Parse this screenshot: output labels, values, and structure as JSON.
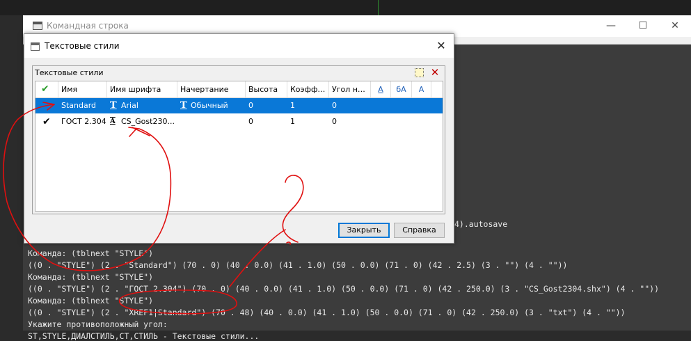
{
  "command_window": {
    "title": "Командная строка",
    "buttons": {
      "minimize": "—",
      "maximize": "☐",
      "close": "✕"
    },
    "output_lines": [
      "4).autosave",
      "Команда: (tblnext \"STYLE\")",
      "((0 . \"STYLE\") (2 . \"Standard\") (70 . 0) (40 . 0.0) (41 . 1.0) (50 . 0.0) (71 . 0) (42 . 2.5) (3 . \"\") (4 . \"\"))",
      "Команда: (tblnext \"STYLE\")",
      "((0 . \"STYLE\") (2 . \"ГОСТ 2.304\") (70 . 0) (40 . 0.0) (41 . 1.0) (50 . 0.0) (71 . 0) (42 . 250.0) (3 . \"CS_Gost2304.shx\") (4 . \"\"))",
      "Команда: (tblnext \"STYLE\")",
      "((0 . \"STYLE\") (2 . \"XREF1|Standard\") (70 . 48) (40 . 0.0) (41 . 1.0) (50 . 0.0) (71 . 0) (42 . 250.0) (3 . \"txt\") (4 . \"\"))",
      "Укажите противоположный угол:",
      "ST,STYLE,ДИАЛСТИЛЬ,СТ,СТИЛЬ - Текстовые стили..."
    ]
  },
  "dialog": {
    "title": "Текстовые стили",
    "close_glyph": "✕",
    "panel_title": "Текстовые стили",
    "columns": [
      "Имя",
      "Имя шрифта",
      "Начертание",
      "Высота",
      "Коэфф…",
      "Угол н…"
    ],
    "header_check": "✔",
    "rows": [
      {
        "check": "",
        "name": "Standard",
        "font_icon": "T",
        "font": "Arial",
        "style_icon": "T",
        "style": "Обычный",
        "height": "0",
        "factor": "1",
        "angle": "0",
        "selected": true
      },
      {
        "check": "✔",
        "name": "ГОСТ 2.304",
        "font_icon": "A",
        "font": "CS_Gost230...",
        "style_icon": "",
        "style": "",
        "height": "0",
        "factor": "1",
        "angle": "0",
        "selected": false
      }
    ],
    "icon_headers": [
      "A",
      "бA",
      "A"
    ],
    "buttons": {
      "close": "Закрыть",
      "help": "Справка"
    }
  },
  "colors": {
    "selection": "#0a78d7",
    "annotation": "#e01010",
    "check": "#2e9e2e"
  }
}
